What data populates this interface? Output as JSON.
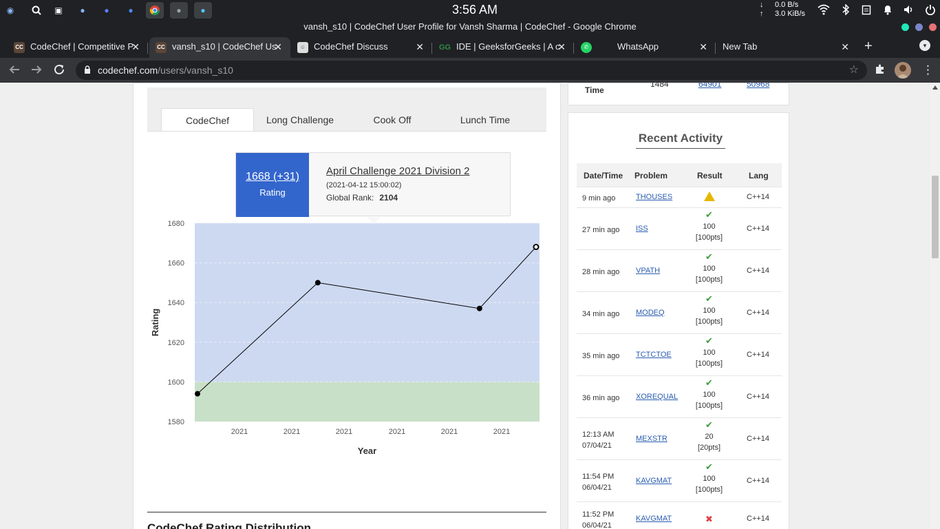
{
  "os": {
    "clock": "3:56 AM",
    "net_down": "0.0 B/s",
    "net_up": "3.0 KiB/s",
    "net_down_arrow": "↓",
    "net_up_arrow": "↑",
    "taskbar_icons": [
      "launcher-icon",
      "search-icon",
      "files-icon",
      "app-icon",
      "app-icon",
      "app-icon",
      "chrome-icon",
      "terminal-icon",
      "app-icon"
    ],
    "tray_icons": [
      "wifi-icon",
      "bluetooth-icon",
      "clipboard-icon",
      "bell-icon",
      "volume-icon",
      "power-icon"
    ]
  },
  "window": {
    "title": "vansh_s10 | CodeChef User Profile for Vansh Sharma | CodeChef - Google Chrome"
  },
  "tabs": [
    {
      "title": "CodeChef | Competitive P",
      "icon": "codechef-icon",
      "active": false
    },
    {
      "title": "vansh_s10 | CodeChef Us",
      "icon": "codechef-icon",
      "active": true
    },
    {
      "title": "CodeChef Discuss",
      "icon": "codechef-discuss-icon",
      "active": false
    },
    {
      "title": "IDE | GeeksforGeeks | A c",
      "icon": "gfg-icon",
      "active": false
    },
    {
      "title": "WhatsApp",
      "icon": "whatsapp-icon",
      "active": false
    },
    {
      "title": "New Tab",
      "icon": "",
      "active": false
    }
  ],
  "toolbar": {
    "url_domain": "codechef.com",
    "url_path": "/users/vansh_s10"
  },
  "rating_tabs": [
    "CodeChef",
    "Long Challenge",
    "Cook Off",
    "Lunch Time"
  ],
  "tooltip": {
    "rating": "1668 (+31)",
    "rating_label": "Rating",
    "contest": "April Challenge 2021 Division 2",
    "date": "(2021-04-12 15:00:02)",
    "rank_label": "Global Rank:",
    "rank_value": "2104"
  },
  "chart_data": {
    "type": "line",
    "xlabel": "Year",
    "ylabel": "Rating",
    "ylim": [
      1580,
      1680
    ],
    "yticks": [
      1580,
      1600,
      1620,
      1640,
      1660,
      1680
    ],
    "xtick_labels": [
      "2021",
      "2021",
      "2021",
      "2021",
      "2021",
      "2021"
    ],
    "points": [
      {
        "x_frac": 0.008,
        "y": 1594
      },
      {
        "x_frac": 0.357,
        "y": 1650
      },
      {
        "x_frac": 0.826,
        "y": 1637
      },
      {
        "x_frac": 0.99,
        "y": 1668
      }
    ],
    "bands": [
      {
        "from": 1580,
        "to": 1600,
        "color": "#c8e0c8"
      },
      {
        "from": 1600,
        "to": 1680,
        "color": "#cdd9f1"
      }
    ]
  },
  "distribution_title": "CodeChef Rating Distribution",
  "time_card": {
    "label": "Time",
    "values": [
      "1484",
      "64901",
      "50968"
    ]
  },
  "activity": {
    "title": "Recent Activity",
    "headers": [
      "Date/Time",
      "Problem",
      "Result",
      "Lang"
    ],
    "rows": [
      {
        "time": "9 min ago",
        "time2": "",
        "problem": "THOUSES",
        "status": "warn",
        "score": "",
        "pts": "",
        "lang": "C++14"
      },
      {
        "time": "27 min ago",
        "time2": "",
        "problem": "ISS",
        "status": "ok",
        "score": "100",
        "pts": "[100pts]",
        "lang": "C++14"
      },
      {
        "time": "28 min ago",
        "time2": "",
        "problem": "VPATH",
        "status": "ok",
        "score": "100",
        "pts": "[100pts]",
        "lang": "C++14"
      },
      {
        "time": "34 min ago",
        "time2": "",
        "problem": "MODEQ",
        "status": "ok",
        "score": "100",
        "pts": "[100pts]",
        "lang": "C++14"
      },
      {
        "time": "35 min ago",
        "time2": "",
        "problem": "TCTCTOE",
        "status": "ok",
        "score": "100",
        "pts": "[100pts]",
        "lang": "C++14"
      },
      {
        "time": "36 min ago",
        "time2": "",
        "problem": "XOREQUAL",
        "status": "ok",
        "score": "100",
        "pts": "[100pts]",
        "lang": "C++14"
      },
      {
        "time": "12:13 AM",
        "time2": "07/04/21",
        "problem": "MEXSTR",
        "status": "ok",
        "score": "20",
        "pts": "[20pts]",
        "lang": "C++14"
      },
      {
        "time": "11:54 PM",
        "time2": "06/04/21",
        "problem": "KAVGMAT",
        "status": "ok",
        "score": "100",
        "pts": "[100pts]",
        "lang": "C++14"
      },
      {
        "time": "11:52 PM",
        "time2": "06/04/21",
        "problem": "KAVGMAT",
        "status": "wrong",
        "score": "",
        "pts": "",
        "lang": "C++14"
      }
    ]
  }
}
